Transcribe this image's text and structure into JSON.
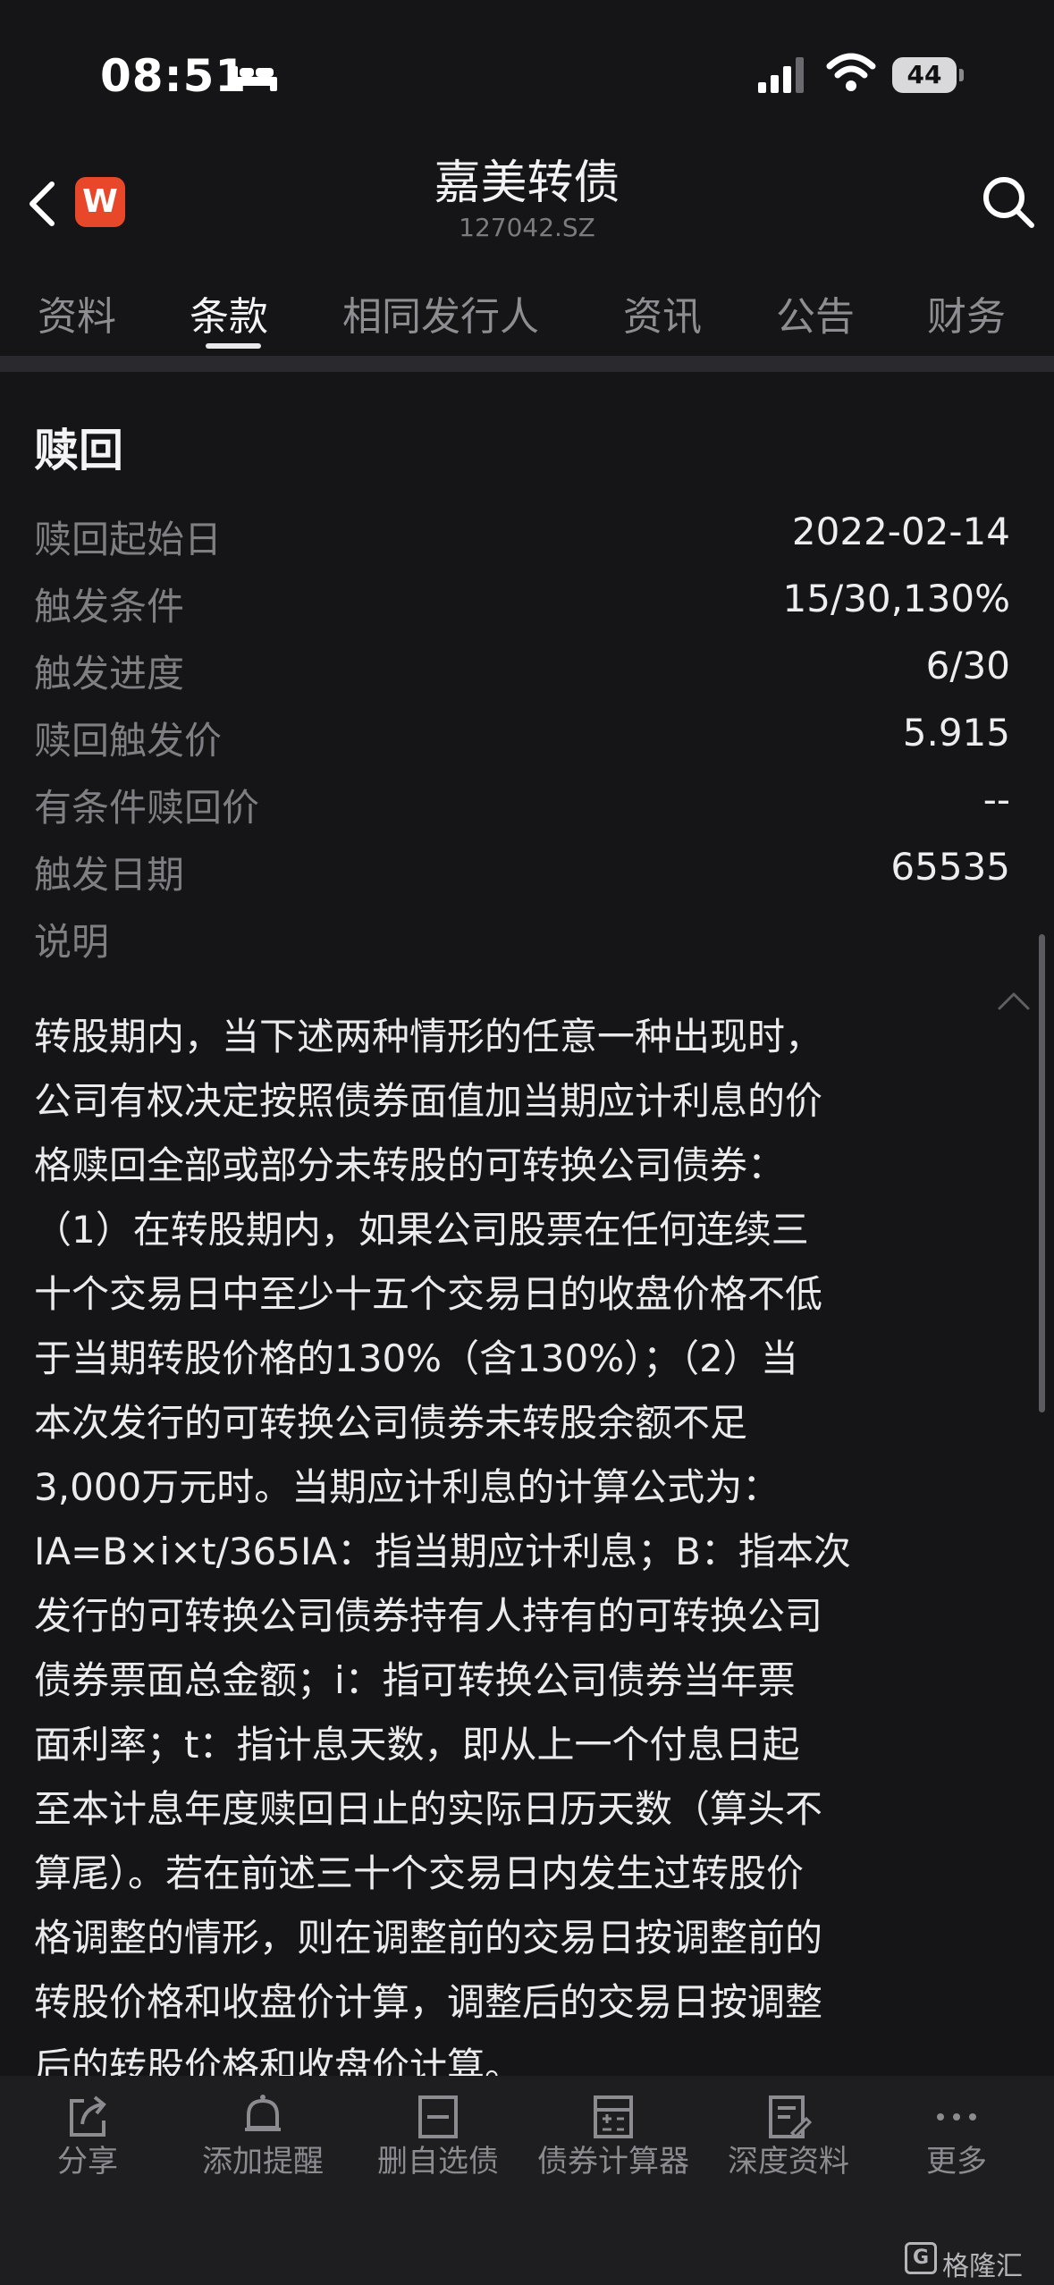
{
  "status_bar": {
    "time": "08:51",
    "battery": "44"
  },
  "header": {
    "title": "嘉美转债",
    "code": "127042.SZ",
    "logo_letter": "W"
  },
  "tabs": [
    "资料",
    "条款",
    "相同发行人",
    "资讯",
    "公告",
    "财务"
  ],
  "active_tab": "条款",
  "section": {
    "title": "赎回",
    "rows": [
      {
        "label": "赎回起始日",
        "value": "2022-02-14"
      },
      {
        "label": "触发条件",
        "value": "15/30,130%"
      },
      {
        "label": "触发进度",
        "value": "6/30"
      },
      {
        "label": "赎回触发价",
        "value": "5.915"
      },
      {
        "label": "有条件赎回价",
        "value": "--"
      },
      {
        "label": "触发日期",
        "value": "65535"
      },
      {
        "label": "说明",
        "value": ""
      }
    ],
    "description_lines": [
      "转股期内，当下述两种情形的任意一种出现时，",
      "公司有权决定按照债券面值加当期应计利息的价",
      "格赎回全部或部分未转股的可转换公司债券：",
      "（1）在转股期内，如果公司股票在任何连续三",
      "十个交易日中至少十五个交易日的收盘价格不低",
      "于当期转股价格的130%（含130%）；（2）当",
      "本次发行的可转换公司债券未转股余额不足",
      "3,000万元时。当期应计利息的计算公式为：",
      "IA=B×i×t/365IA：指当期应计利息；B：指本次",
      "发行的可转换公司债券持有人持有的可转换公司",
      "债券票面总金额；i：指可转换公司债券当年票",
      "面利率；t：指计息天数，即从上一个付息日起",
      "至本计息年度赎回日止的实际日历天数（算头不",
      "算尾）。若在前述三十个交易日内发生过转股价",
      "格调整的情形，则在调整前的交易日按调整前的",
      "转股价格和收盘价计算，调整后的交易日按调整",
      "后的转股价格和收盘价计算。"
    ]
  },
  "toolbar": [
    {
      "label": "分享",
      "icon": "share-icon"
    },
    {
      "label": "添加提醒",
      "icon": "bell-icon"
    },
    {
      "label": "删自选债",
      "icon": "minus-box-icon"
    },
    {
      "label": "债券计算器",
      "icon": "calculator-icon"
    },
    {
      "label": "深度资料",
      "icon": "document-icon"
    },
    {
      "label": "更多",
      "icon": "more-icon"
    }
  ],
  "watermark": "格隆汇",
  "colors": {
    "background": "#151517",
    "accent_logo": "#e8472a"
  }
}
